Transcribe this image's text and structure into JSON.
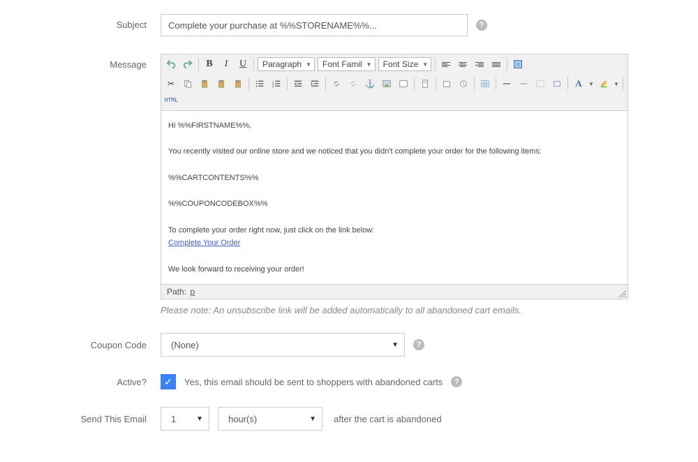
{
  "subject": {
    "label": "Subject",
    "value": "Complete your purchase at %%STORENAME%%..."
  },
  "message": {
    "label": "Message",
    "toolbar": {
      "format_select": "Paragraph",
      "font_family_select": "Font Famil",
      "font_size_select": "Font Size",
      "html_label": "HTML"
    },
    "body": {
      "line1": "Hi %%FIRSTNAME%%,",
      "line2": "You recently visited our online store and we noticed that you didn't complete your order for the following items:",
      "line3": "%%CARTCONTENTS%%",
      "line4": "%%COUPONCODEBOX%%",
      "line5": "To complete your order right now, just click on the link below:",
      "link": "Complete Your Order",
      "line6": "We look forward to receiving your order!"
    },
    "path_label": "Path:",
    "path_value": "p",
    "note": "Please note: An unsubscribe link will be added automatically to all abandoned cart emails."
  },
  "coupon": {
    "label": "Coupon Code",
    "value": "(None)"
  },
  "active": {
    "label": "Active?",
    "checked": true,
    "text": "Yes, this email should be sent to shoppers with abandoned carts"
  },
  "send": {
    "label": "Send This Email",
    "qty": "1",
    "unit": "hour(s)",
    "after_text": "after the cart is abandoned"
  }
}
